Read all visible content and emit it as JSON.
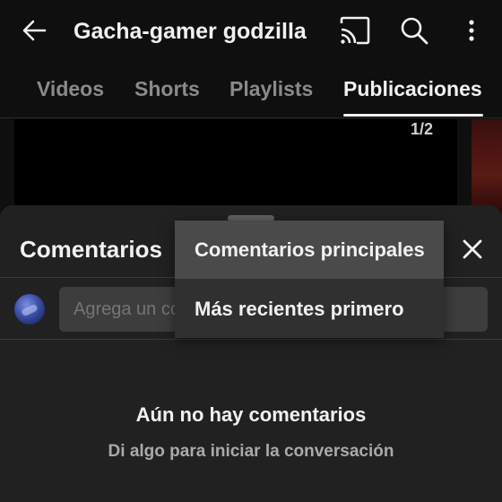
{
  "appbar": {
    "title": "Gacha-gamer godzilla",
    "icons": [
      "back-arrow-icon",
      "cast-icon",
      "search-icon",
      "more-vert-icon"
    ]
  },
  "tabs": [
    {
      "label": "Videos",
      "active": false
    },
    {
      "label": "Shorts",
      "active": false
    },
    {
      "label": "Playlists",
      "active": false
    },
    {
      "label": "Publicaciones",
      "active": true
    }
  ],
  "content": {
    "page_indicator": "1/2"
  },
  "sheet": {
    "title": "Comentarios",
    "composer": {
      "placeholder": "Agrega un comentario..."
    },
    "empty_state": {
      "title": "Aún no hay comentarios",
      "subtitle": "Di algo para iniciar la conversación"
    }
  },
  "sort_menu": {
    "items": [
      {
        "label": "Comentarios principales",
        "selected": true
      },
      {
        "label": "Más recientes primero",
        "selected": false
      }
    ]
  },
  "colors": {
    "background": "#0f0f0f",
    "sheet": "#212121",
    "menu": "#303030",
    "menu_selected": "#4a4a4a",
    "text_primary": "#f1f1f1",
    "text_secondary": "#aaaaaa"
  }
}
